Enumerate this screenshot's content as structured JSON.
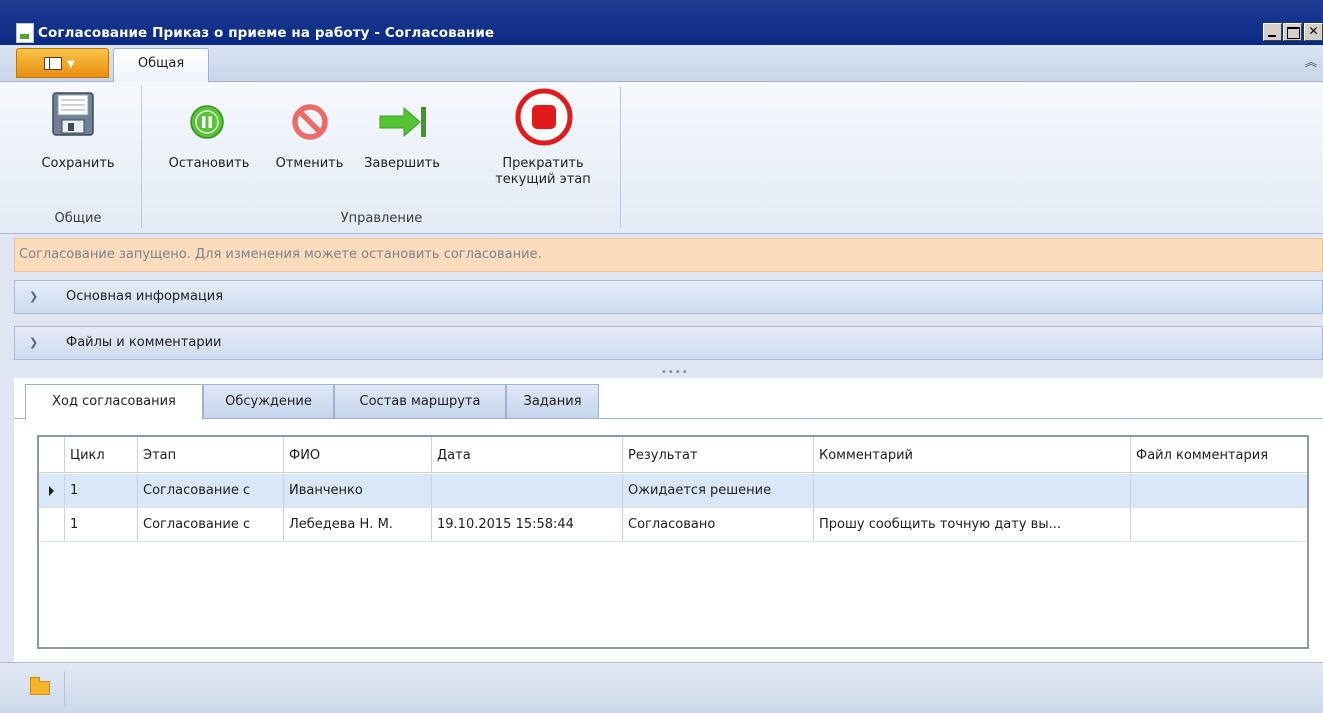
{
  "window": {
    "title": "Согласование Приказ о приеме на работу - Согласование"
  },
  "ribbon": {
    "tab_label": "Общая",
    "groups": {
      "general": {
        "label": "Общие",
        "save_label": "Сохранить"
      },
      "control": {
        "label": "Управление",
        "stop_label": "Остановить",
        "cancel_label": "Отменить",
        "finish_label": "Завершить",
        "terminate_label_1": "Прекратить",
        "terminate_label_2": "текущий этап"
      }
    }
  },
  "info_message": "Согласование запущено. Для изменения можете остановить согласование.",
  "panels": {
    "main_info": "Основная информация",
    "files_comments": "Файлы и комментарии"
  },
  "tabs": {
    "progress": "Ход согласования",
    "discussion": "Обсуждение",
    "route": "Состав маршрута",
    "tasks": "Задания"
  },
  "grid": {
    "columns": {
      "cycle": "Цикл",
      "stage": "Этап",
      "name": "ФИО",
      "date": "Дата",
      "result": "Результат",
      "comment": "Комментарий",
      "comment_file": "Файл комментария"
    },
    "rows": [
      {
        "cycle": "1",
        "stage": "Согласование с",
        "name": "Иванченко",
        "date": "",
        "result": "Ожидается решение",
        "comment": "",
        "comment_file": ""
      },
      {
        "cycle": "1",
        "stage": "Согласование с",
        "name": "Лебедева Н. М.",
        "date": "19.10.2015 15:58:44",
        "result": "Согласовано",
        "comment": "Прошу сообщить точную дату вы...",
        "comment_file": ""
      }
    ]
  },
  "colors": {
    "title_bar": "#0b2a83",
    "info_bar": "#fbdcbd",
    "selected_row": "#d9e7f7"
  }
}
